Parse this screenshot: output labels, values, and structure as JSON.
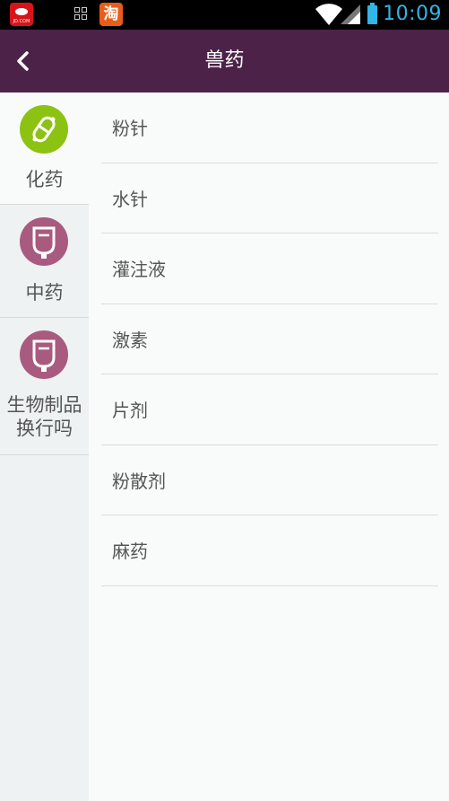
{
  "status_bar": {
    "time": "10:09",
    "jd_label": "JD.COM",
    "taobao_label": "淘",
    "icons": [
      "jd-app-icon",
      "grid-icon",
      "taobao-app-icon",
      "wifi-icon",
      "signal-icon",
      "battery-icon"
    ],
    "time_color": "#33b5e5"
  },
  "header": {
    "title": "兽药",
    "back_icon": "chevron-left-icon",
    "background": "#4c2248"
  },
  "sidebar": {
    "items": [
      {
        "label": "化药",
        "icon": "pill-icon",
        "icon_color": "#8cc313",
        "active": true
      },
      {
        "label": "中药",
        "icon": "iv-bag-icon",
        "icon_color": "#a95b7f",
        "active": false
      },
      {
        "label": "生物制品换行吗",
        "icon": "iv-bag-icon",
        "icon_color": "#a95b7f",
        "active": false
      }
    ]
  },
  "list": {
    "items": [
      {
        "label": "粉针"
      },
      {
        "label": "水针"
      },
      {
        "label": "灌注液"
      },
      {
        "label": "激素"
      },
      {
        "label": "片剂"
      },
      {
        "label": "粉散剂"
      },
      {
        "label": "麻药"
      }
    ]
  }
}
